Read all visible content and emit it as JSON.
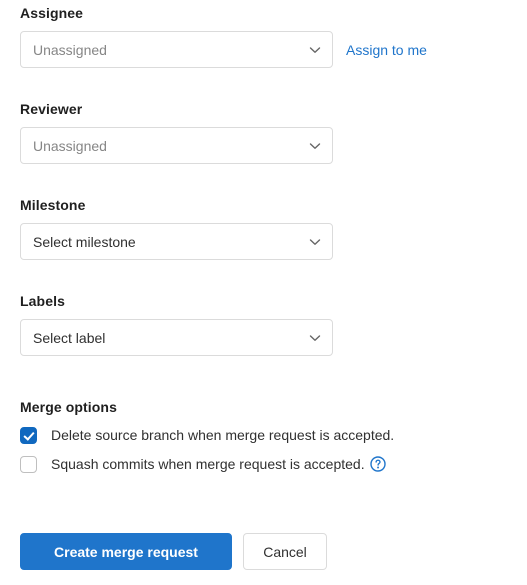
{
  "fields": {
    "assignee": {
      "label": "Assignee",
      "value": "Unassigned",
      "is_placeholder": true,
      "link_label": "Assign to me"
    },
    "reviewer": {
      "label": "Reviewer",
      "value": "Unassigned",
      "is_placeholder": true
    },
    "milestone": {
      "label": "Milestone",
      "value": "Select milestone",
      "is_placeholder": false
    },
    "labels": {
      "label": "Labels",
      "value": "Select label",
      "is_placeholder": false
    }
  },
  "merge_options": {
    "label": "Merge options",
    "items": [
      {
        "text": "Delete source branch when merge request is accepted.",
        "checked": true,
        "has_help": false
      },
      {
        "text": "Squash commits when merge request is accepted.",
        "checked": false,
        "has_help": true
      }
    ]
  },
  "actions": {
    "submit_label": "Create merge request",
    "cancel_label": "Cancel"
  },
  "icons": {
    "chevron_down": "chevron-down-icon",
    "help": "question-circle-icon",
    "check": "check-icon"
  },
  "colors": {
    "accent_blue": "#1f75cb",
    "checkbox_blue": "#1068bf",
    "border": "#dbdbdb",
    "text": "#303030",
    "heading": "#1f1f1f",
    "placeholder": "#868686"
  }
}
